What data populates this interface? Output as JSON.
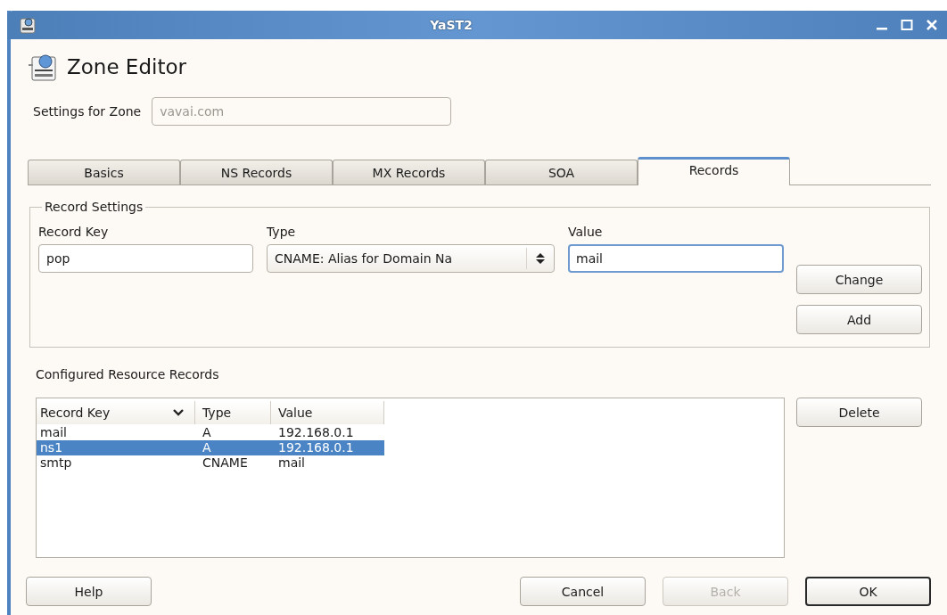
{
  "window": {
    "title": "YaST2"
  },
  "heading": "Zone Editor",
  "zone": {
    "label": "Settings for Zone",
    "value": "vavai.com",
    "disabled": true
  },
  "tabs": [
    {
      "label": "Basics",
      "selected": false
    },
    {
      "label": "NS Records",
      "selected": false
    },
    {
      "label": "MX Records",
      "selected": false
    },
    {
      "label": "SOA",
      "selected": false
    },
    {
      "label": "Records",
      "selected": true
    }
  ],
  "record_settings": {
    "title": "Record Settings",
    "fields": [
      {
        "kind": "text",
        "label": "Record Key",
        "value": "pop",
        "focused": false
      },
      {
        "kind": "combo",
        "label": "Type",
        "value": "CNAME: Alias for Domain Na"
      },
      {
        "kind": "text",
        "label": "Value",
        "value": "mail",
        "focused": true
      }
    ],
    "buttons": [
      {
        "label": "Change"
      },
      {
        "label": "Add"
      }
    ]
  },
  "records": {
    "title": "Configured Resource Records",
    "columns": [
      {
        "label": "Record Key",
        "sorted": true
      },
      {
        "label": "Type",
        "sorted": false
      },
      {
        "label": "Value",
        "sorted": false
      }
    ],
    "rows": [
      {
        "cells": [
          "mail",
          "A",
          "192.168.0.1"
        ],
        "selected": false
      },
      {
        "cells": [
          "ns1",
          "A",
          "192.168.0.1"
        ],
        "selected": true
      },
      {
        "cells": [
          "smtp",
          "CNAME",
          "mail"
        ],
        "selected": false
      }
    ],
    "buttons": [
      {
        "label": "Delete"
      }
    ]
  },
  "footer": {
    "left": [
      {
        "label": "Help",
        "disabled": false,
        "default": false
      }
    ],
    "right": [
      {
        "label": "Cancel",
        "disabled": false,
        "default": false
      },
      {
        "label": "Back",
        "disabled": true,
        "default": false
      },
      {
        "label": "OK",
        "disabled": false,
        "default": true
      }
    ]
  }
}
